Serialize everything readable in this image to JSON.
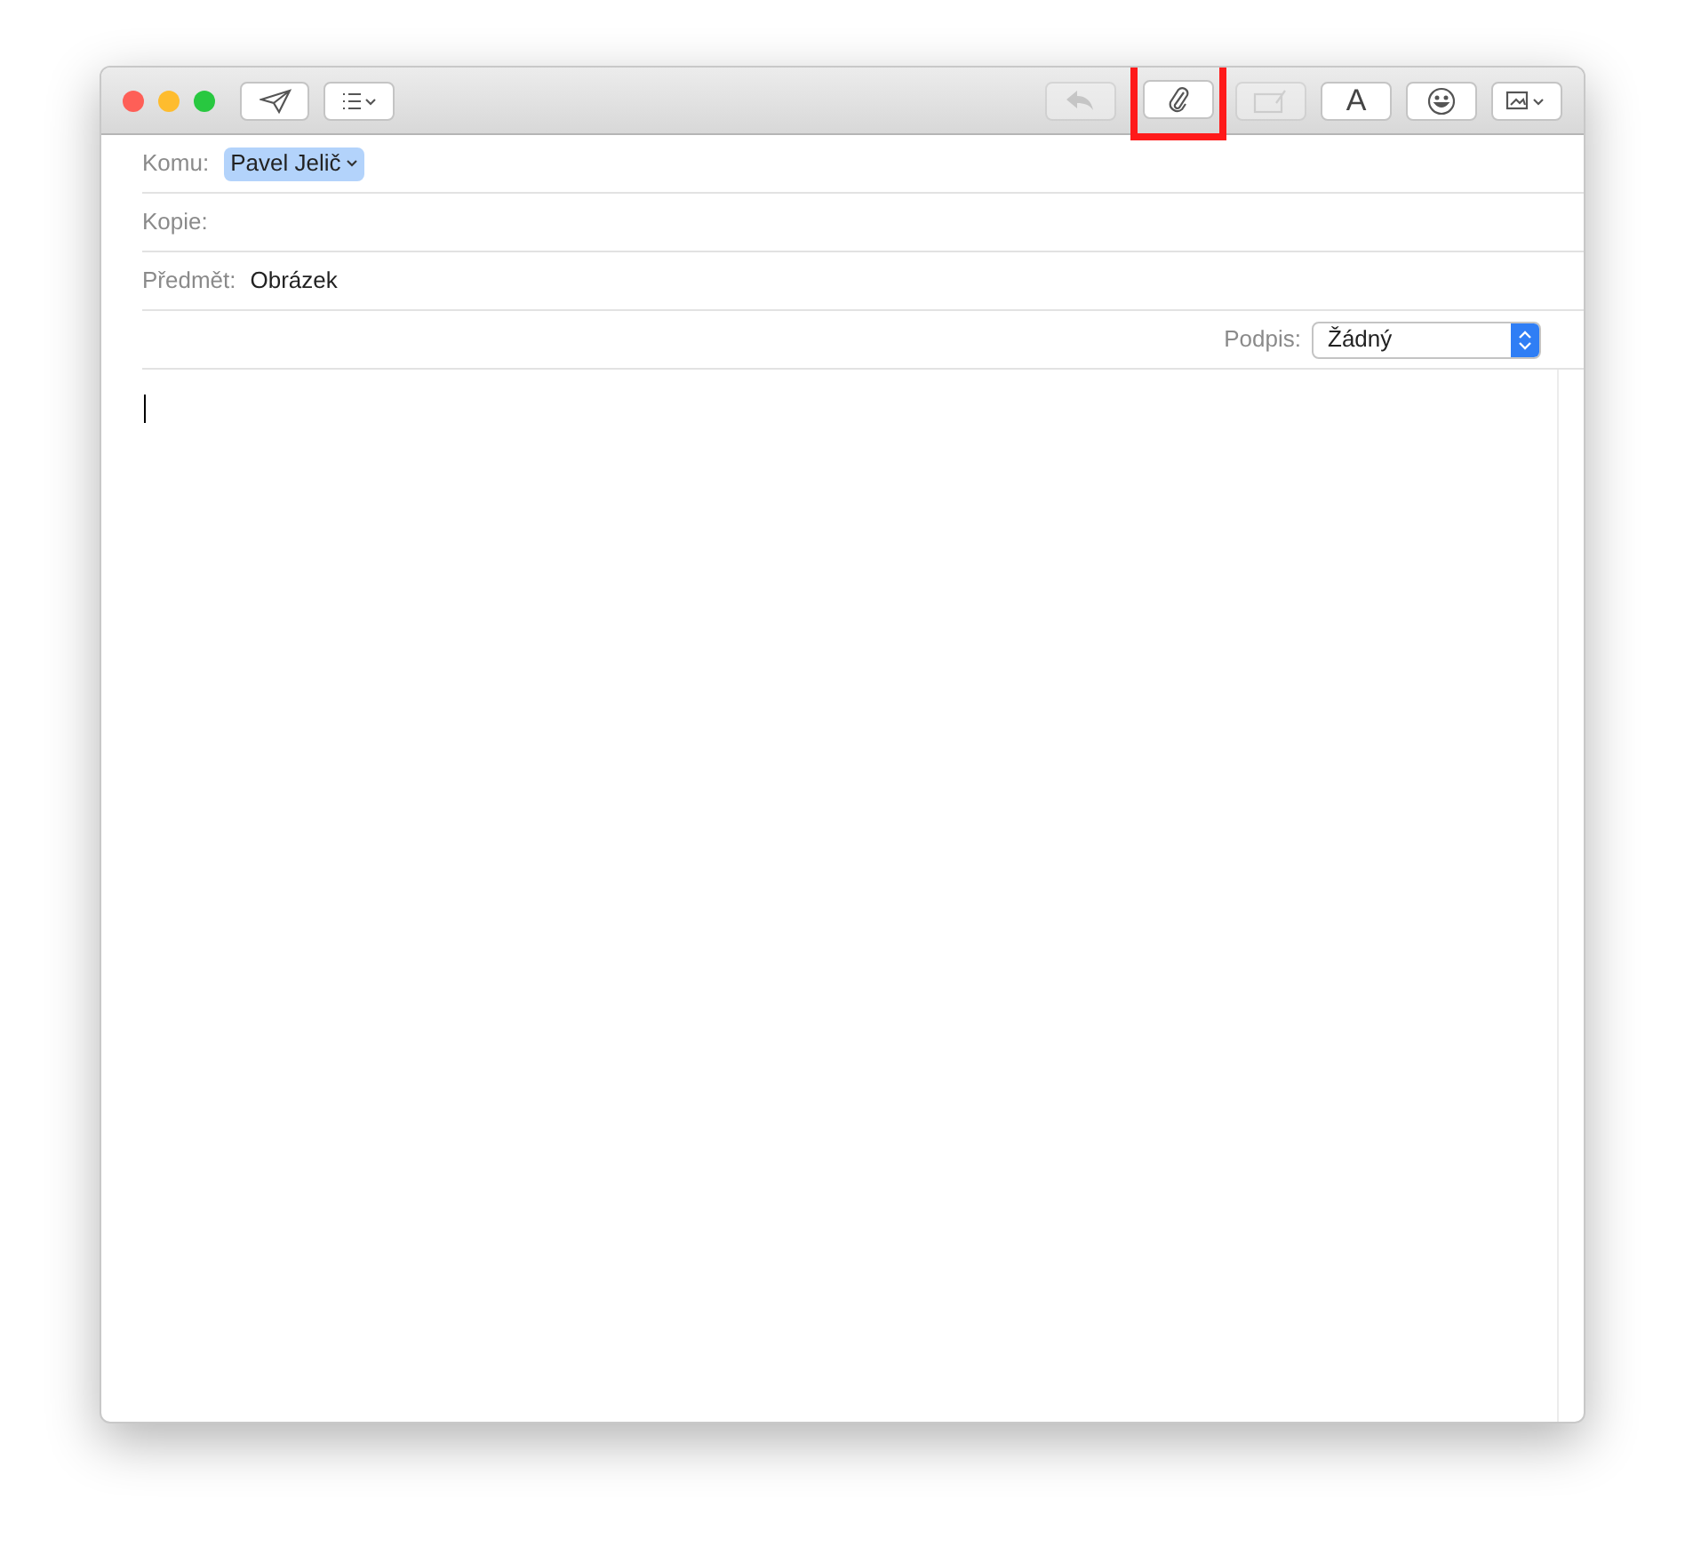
{
  "toolbar_left": [
    {
      "kind": "send",
      "disabled": false
    },
    {
      "kind": "list",
      "disabled": false
    }
  ],
  "toolbar_right": [
    {
      "kind": "reply",
      "disabled": true,
      "highlighted": false
    },
    {
      "kind": "attach",
      "disabled": false,
      "highlighted": true
    },
    {
      "kind": "markup",
      "disabled": true,
      "highlighted": false
    },
    {
      "kind": "font",
      "label": "A",
      "disabled": false,
      "highlighted": false
    },
    {
      "kind": "emoji",
      "disabled": false,
      "highlighted": false
    },
    {
      "kind": "photo",
      "disabled": false,
      "highlighted": false
    }
  ],
  "fields": [
    {
      "label": "Komu:",
      "kind": "recipient",
      "value": "Pavel Jelič"
    },
    {
      "label": "Kopie:",
      "kind": "text"
    },
    {
      "label": "Předmět:",
      "kind": "text",
      "value": "Obrázek"
    }
  ],
  "signature": {
    "label": "Podpis:",
    "value": "Žádný"
  }
}
